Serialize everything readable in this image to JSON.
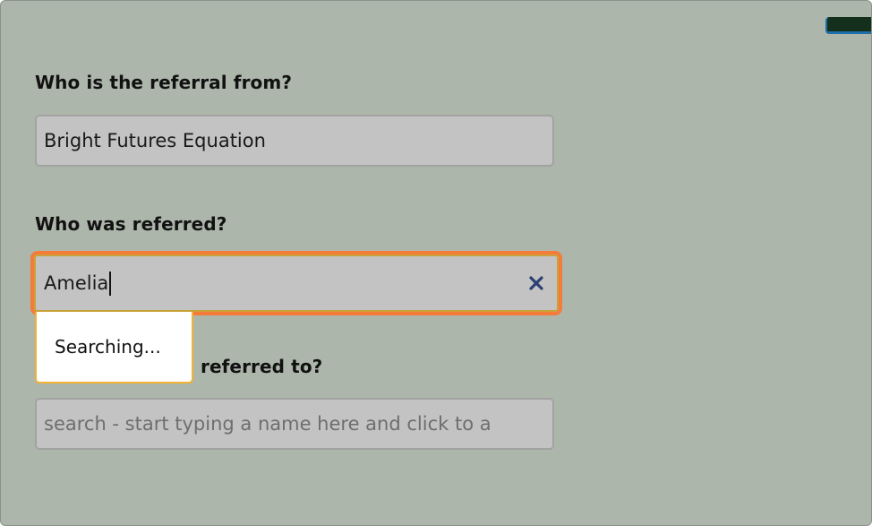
{
  "referral_from": {
    "label": "Who is the referral from?",
    "value": "Bright Futures Equation"
  },
  "referred_person": {
    "label": "Who was referred?",
    "value": "Amelia",
    "dropdown_status": "Searching..."
  },
  "referred_to": {
    "label_visible": "referred to?",
    "placeholder": "search - start typing a name here and click to a"
  },
  "colors": {
    "background": "#adb6ab",
    "focus_border": "#f47b3a",
    "dropdown_border": "#f2b233",
    "clear_icon": "#2b3f73"
  },
  "icons": {
    "clear": "close-icon"
  }
}
